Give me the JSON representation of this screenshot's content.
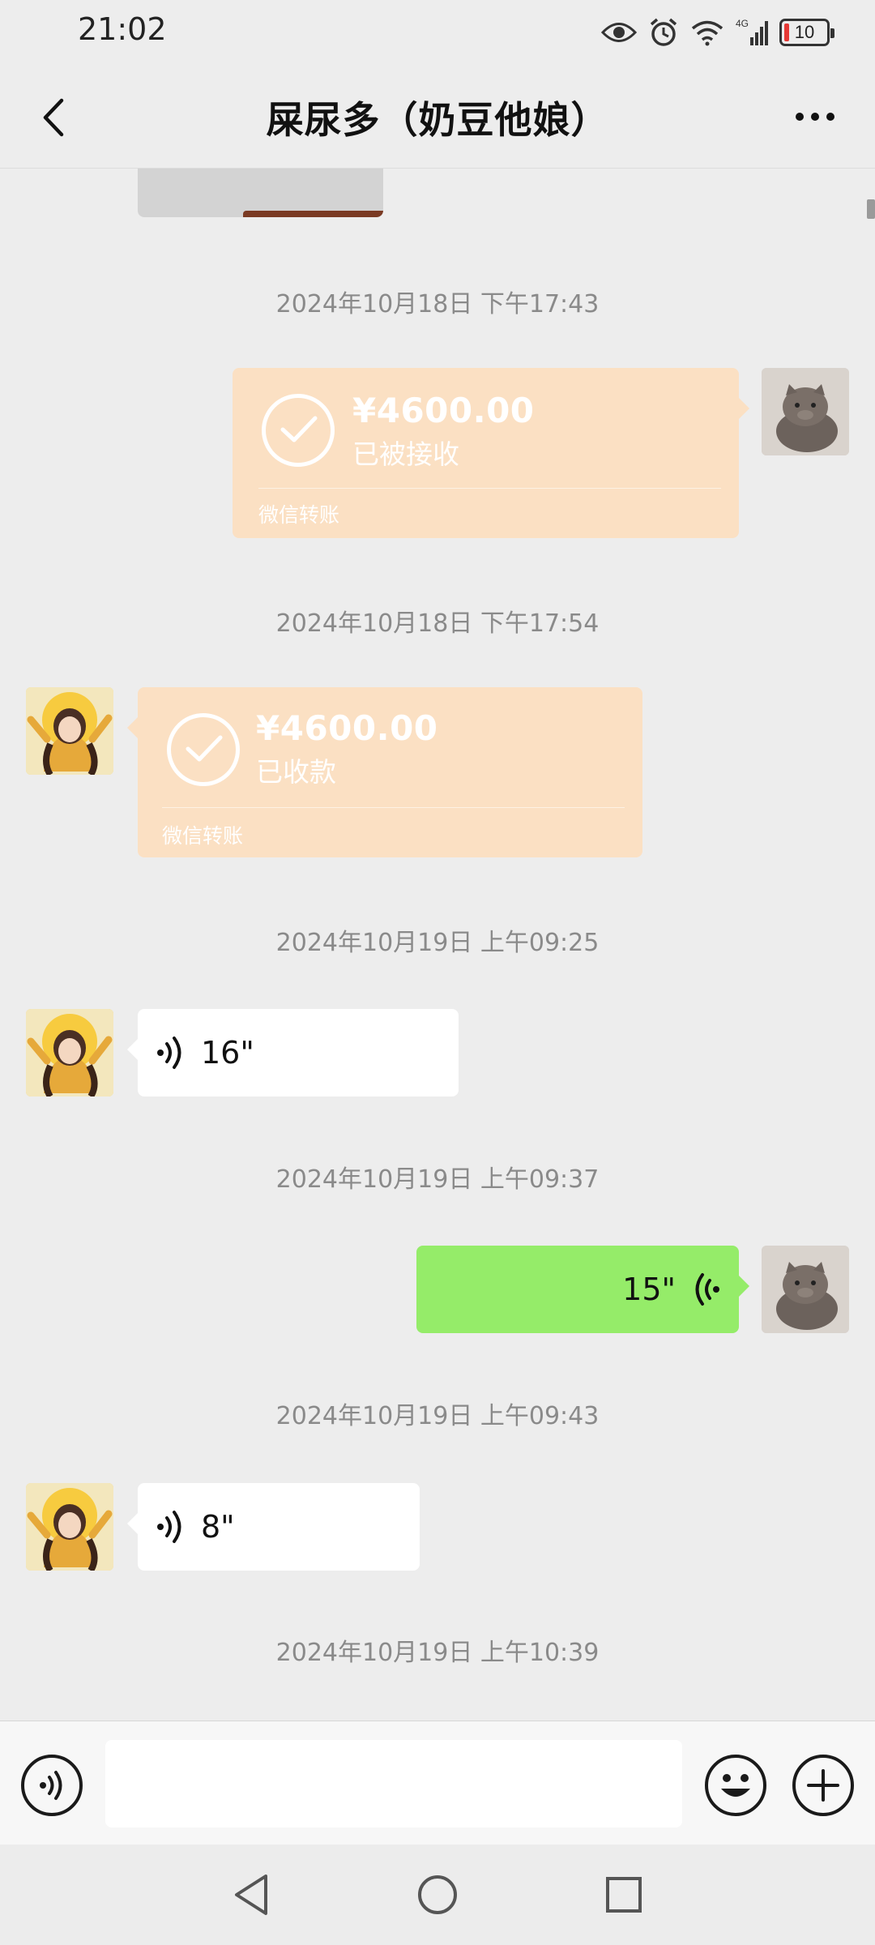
{
  "status_bar": {
    "time": "21:02",
    "network": "4G",
    "battery": "10",
    "icons": [
      "eye-icon",
      "alarm-icon",
      "wifi-icon",
      "signal-icon",
      "battery-icon"
    ]
  },
  "header": {
    "title": "屎尿多（奶豆他娘）",
    "back_icon": "chevron-left-icon",
    "more_icon": "more-dots-icon"
  },
  "messages": [
    {
      "type": "timestamp",
      "text": "2024年10月18日 下午17:43"
    },
    {
      "type": "transfer",
      "side": "right",
      "amount": "¥4600.00",
      "status": "已被接收",
      "label": "微信转账"
    },
    {
      "type": "timestamp",
      "text": "2024年10月18日 下午17:54"
    },
    {
      "type": "transfer",
      "side": "left",
      "amount": "¥4600.00",
      "status": "已收款",
      "label": "微信转账"
    },
    {
      "type": "timestamp",
      "text": "2024年10月19日 上午09:25"
    },
    {
      "type": "voice",
      "side": "left",
      "duration": "16\""
    },
    {
      "type": "timestamp",
      "text": "2024年10月19日 上午09:37"
    },
    {
      "type": "voice",
      "side": "right",
      "duration": "15\""
    },
    {
      "type": "timestamp",
      "text": "2024年10月19日 上午09:43"
    },
    {
      "type": "voice",
      "side": "left",
      "duration": "8\""
    },
    {
      "type": "timestamp",
      "text": "2024年10月19日 上午10:39"
    }
  ],
  "input_bar": {
    "value": "",
    "voice_icon": "voice-input-icon",
    "emoji_icon": "emoji-icon",
    "plus_icon": "plus-icon"
  },
  "colors": {
    "background": "#ededed",
    "transfer_bubble": "#fbe0c3",
    "sent_bubble": "#95ec69",
    "received_bubble": "#ffffff",
    "timestamp_text": "#8a8a8a"
  }
}
